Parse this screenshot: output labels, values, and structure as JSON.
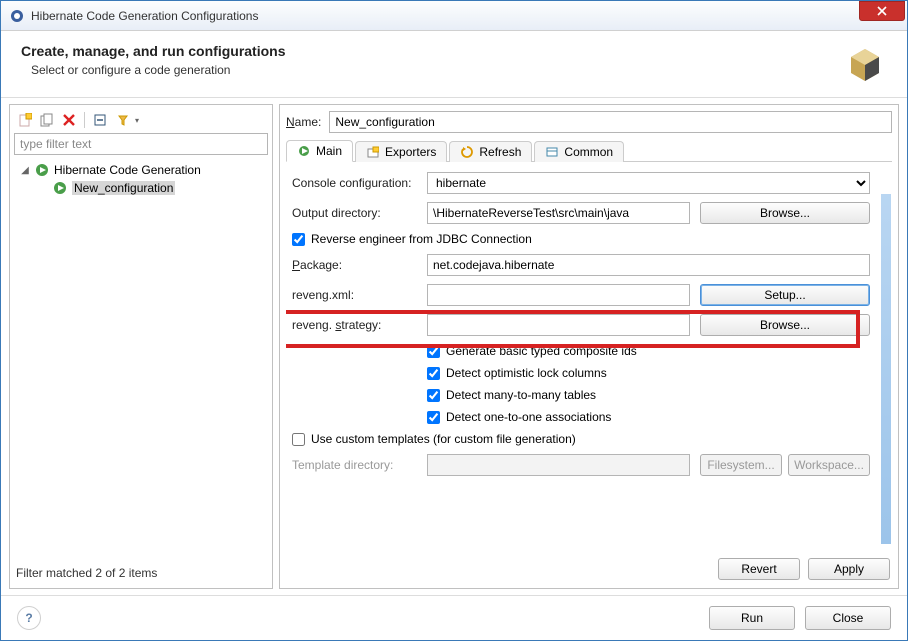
{
  "window": {
    "title": "Hibernate Code Generation Configurations"
  },
  "header": {
    "title": "Create, manage, and run configurations",
    "subtitle": "Select or configure a code generation"
  },
  "left": {
    "filter_placeholder": "type filter text",
    "tree": {
      "root_label": "Hibernate Code Generation",
      "child_label": "New_configuration"
    },
    "filter_status": "Filter matched 2 of 2 items"
  },
  "right": {
    "name_label": "Name:",
    "name_value": "New_configuration",
    "tabs": {
      "main": "Main",
      "exporters": "Exporters",
      "refresh": "Refresh",
      "common": "Common"
    },
    "main": {
      "console_label": "Console configuration:",
      "console_value": "hibernate",
      "outdir_label": "Output directory:",
      "outdir_value": "\\HibernateReverseTest\\src\\main\\java",
      "browse": "Browse...",
      "reverse_cb": "Reverse engineer from JDBC Connection",
      "package_label": "Package:",
      "package_value": "net.codejava.hibernate",
      "reveng_label": "reveng.xml:",
      "reveng_value": "",
      "setup": "Setup...",
      "strategy_label": "reveng. strategy:",
      "strategy_value": "",
      "cb_basic": "Generate basic typed composite ids",
      "cb_lock": "Detect optimistic lock columns",
      "cb_m2m": "Detect many-to-many tables",
      "cb_o2o": "Detect one-to-one associations",
      "cb_custom": "Use custom templates (for custom file generation)",
      "template_label": "Template directory:",
      "filesystem": "Filesystem...",
      "workspace": "Workspace..."
    },
    "actions": {
      "revert": "Revert",
      "apply": "Apply"
    }
  },
  "footer": {
    "run": "Run",
    "close": "Close"
  }
}
